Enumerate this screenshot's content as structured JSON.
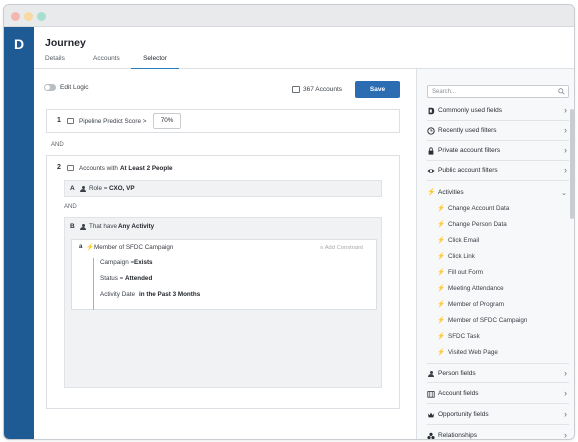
{
  "app": {
    "logo_letter": "D"
  },
  "header": {
    "title": "Journey",
    "tabs": [
      {
        "label": "Details",
        "active": false
      },
      {
        "label": "Accounts",
        "active": false
      },
      {
        "label": "Selector",
        "active": true
      }
    ]
  },
  "toolbar": {
    "edit_logic_label": "Edit Logic",
    "edit_logic_on": false,
    "accounts_count": "367 Accounts",
    "save_label": "Save"
  },
  "rules": {
    "rule1": {
      "number": "1",
      "label": "Pipeline Predict Score >",
      "value": "70%"
    },
    "and_1": "AND",
    "rule2": {
      "number": "2",
      "label_prefix": "Accounts with",
      "label_bold": "At Least 2 People",
      "sub_a": {
        "letter": "A",
        "label": "Role =",
        "value": "CXO, VP"
      },
      "and_2": "AND",
      "sub_b": {
        "letter": "B",
        "label_prefix": "That have",
        "label_bold": "Any Activity",
        "activity": {
          "letter": "a",
          "label": "Member of SFDC Campaign",
          "add_constraint": "Add Constraint",
          "constraints": [
            {
              "key": "Campaign =",
              "value": "Exists"
            },
            {
              "key": "Status =",
              "value": "Attended"
            },
            {
              "key": "Activity Date",
              "value": "in the Past 3 Months"
            }
          ]
        }
      }
    }
  },
  "sidepanel": {
    "search_placeholder": "Search...",
    "categories_top": [
      {
        "label": "Commonly used fields",
        "icon": "d-logo-icon"
      },
      {
        "label": "Recently used filters",
        "icon": "clock-icon"
      },
      {
        "label": "Private account filters",
        "icon": "lock-icon"
      },
      {
        "label": "Public account filters",
        "icon": "eye-icon"
      }
    ],
    "activities": {
      "label": "Activities",
      "expanded": true,
      "items": [
        "Change Account Data",
        "Change Person Data",
        "Click Email",
        "Click Link",
        "Fill out Form",
        "Meeting Attendance",
        "Member of Program",
        "Member of SFDC Campaign",
        "SFDC Task",
        "Visited Web Page"
      ]
    },
    "categories_bottom": [
      {
        "label": "Person fields",
        "icon": "person-icon"
      },
      {
        "label": "Account fields",
        "icon": "building-icon"
      },
      {
        "label": "Opportunity fields",
        "icon": "crown-icon"
      },
      {
        "label": "Relationships",
        "icon": "relationships-icon"
      }
    ]
  },
  "colors": {
    "brand": "#1e5a94",
    "save": "#2b6cb3",
    "accent_line": "#8fb7de"
  }
}
